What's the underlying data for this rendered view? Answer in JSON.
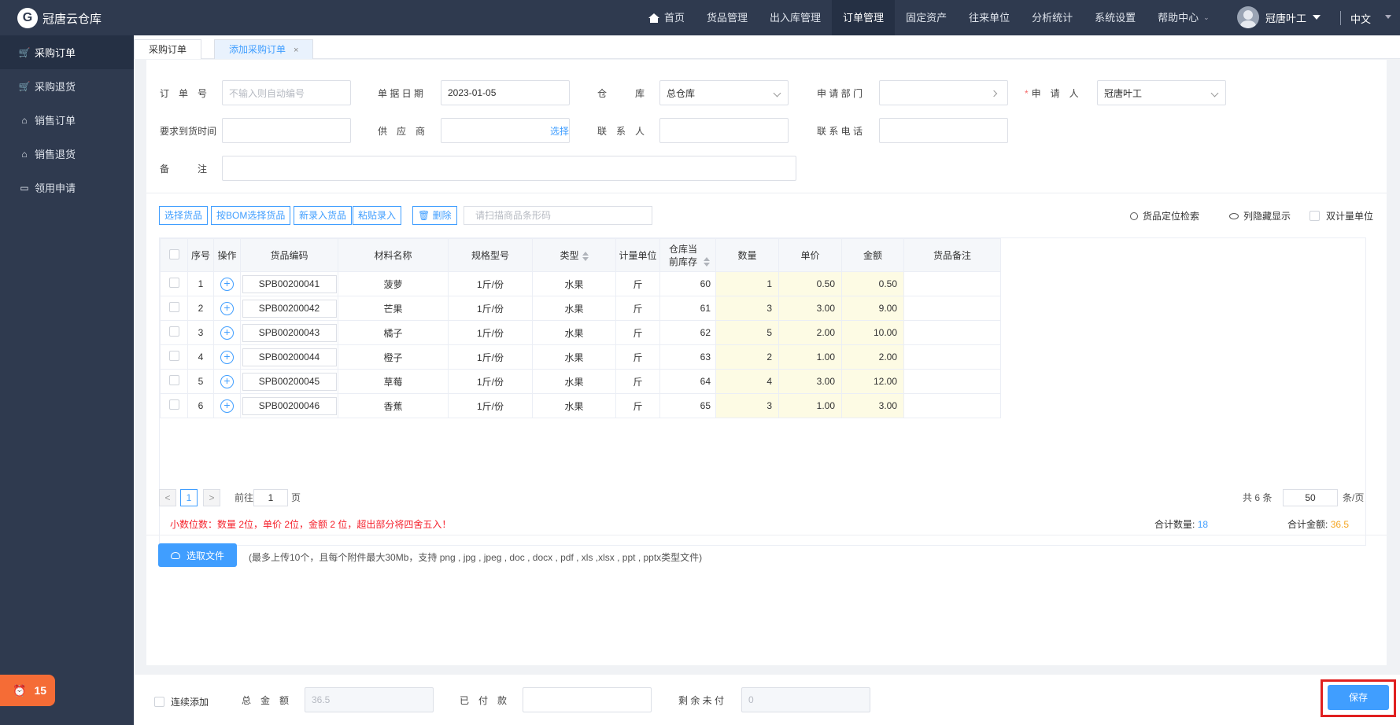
{
  "app": {
    "name": "冠唐云仓库",
    "logo_letter": "G"
  },
  "nav": {
    "home": "首页",
    "items": [
      "货品管理",
      "出入库管理",
      "订单管理",
      "固定资产",
      "往来单位",
      "分析统计",
      "系统设置",
      "帮助中心"
    ],
    "user": "冠唐叶工",
    "lang": "中文"
  },
  "sidebar": {
    "items": [
      "采购订单",
      "采购退货",
      "销售订单",
      "销售退货",
      "领用申请"
    ],
    "badge_count": "15"
  },
  "tabs": {
    "tab1": "采购订单",
    "tab2": "添加采购订单",
    "close": "×"
  },
  "form": {
    "order_no": {
      "label": "订　单　号",
      "placeholder": "不输入则自动编号"
    },
    "doc_date": {
      "label": "单 据 日 期",
      "value": "2023-01-05"
    },
    "warehouse": {
      "label": "仓　　　库",
      "value": "总仓库"
    },
    "dept": {
      "label": "申 请 部 门",
      "value": ""
    },
    "applicant": {
      "label": "申　请　人",
      "value": "冠唐叶工"
    },
    "arrival_time": {
      "label": "要求到货时间",
      "value": ""
    },
    "supplier": {
      "label": "供　应　商",
      "value": "",
      "select": "选择"
    },
    "contact": {
      "label": "联　系　人",
      "value": ""
    },
    "phone": {
      "label": "联 系 电 话",
      "value": ""
    },
    "remark": {
      "label": "备　　　注",
      "value": ""
    }
  },
  "toolbar": {
    "select_goods": "选择货品",
    "bom_select": "按BOM选择货品",
    "new_goods": "新录入货品",
    "paste": "粘贴录入",
    "delete": "删除",
    "scan_placeholder": "请扫描商品条形码",
    "locate": "货品定位检索",
    "col_toggle": "列隐藏显示",
    "dual_unit": "双计量单位"
  },
  "table": {
    "headers": {
      "seq": "序号",
      "op": "操作",
      "code": "货品编码",
      "name": "材料名称",
      "spec": "规格型号",
      "type": "类型",
      "unit": "计量单位",
      "stock": "仓库当前库存",
      "qty": "数量",
      "price": "单价",
      "amount": "金额",
      "note": "货品备注"
    },
    "rows": [
      {
        "seq": "1",
        "code": "SPB00200041",
        "name": "菠萝",
        "spec": "1斤/份",
        "type": "水果",
        "unit": "斤",
        "stock": "60",
        "qty": "1",
        "price": "0.50",
        "amount": "0.50"
      },
      {
        "seq": "2",
        "code": "SPB00200042",
        "name": "芒果",
        "spec": "1斤/份",
        "type": "水果",
        "unit": "斤",
        "stock": "61",
        "qty": "3",
        "price": "3.00",
        "amount": "9.00"
      },
      {
        "seq": "3",
        "code": "SPB00200043",
        "name": "橘子",
        "spec": "1斤/份",
        "type": "水果",
        "unit": "斤",
        "stock": "62",
        "qty": "5",
        "price": "2.00",
        "amount": "10.00"
      },
      {
        "seq": "4",
        "code": "SPB00200044",
        "name": "橙子",
        "spec": "1斤/份",
        "type": "水果",
        "unit": "斤",
        "stock": "63",
        "qty": "2",
        "price": "1.00",
        "amount": "2.00"
      },
      {
        "seq": "5",
        "code": "SPB00200045",
        "name": "草莓",
        "spec": "1斤/份",
        "type": "水果",
        "unit": "斤",
        "stock": "64",
        "qty": "4",
        "price": "3.00",
        "amount": "12.00"
      },
      {
        "seq": "6",
        "code": "SPB00200046",
        "name": "香蕉",
        "spec": "1斤/份",
        "type": "水果",
        "unit": "斤",
        "stock": "65",
        "qty": "3",
        "price": "1.00",
        "amount": "3.00"
      }
    ]
  },
  "pagination": {
    "prev": "<",
    "current": "1",
    "next": ">",
    "goto_prefix": "前往",
    "goto_value": "1",
    "goto_suffix": "页",
    "total": "共 6 条",
    "page_size": "50",
    "page_size_suffix": "条/页"
  },
  "summary": {
    "warning": "小数位数：数量 2位，单价 2位，金额 2 位，超出部分将四舍五入！",
    "total_qty_label": "合计数量:",
    "total_qty": "18",
    "total_amount_label": "合计金额:",
    "total_amount": "36.5"
  },
  "upload": {
    "button": "选取文件",
    "hint": "(最多上传10个，且每个附件最大30Mb，支持 png , jpg , jpeg , doc , docx , pdf , xls ,xlsx , ppt , pptx类型文件)"
  },
  "footer": {
    "continuous_add": "连续添加",
    "total_label": "总　金　额",
    "total_value": "36.5",
    "paid_label": "已　付　款",
    "paid_value": "",
    "remaining_label": "剩 余 未 付",
    "remaining_value": "0",
    "save": "保存"
  },
  "colors": {
    "accent": "#409eff",
    "nav_bg": "#2f3a4f",
    "warning": "#f5222d",
    "badge": "#f56c36",
    "highlight": "#e02020"
  }
}
